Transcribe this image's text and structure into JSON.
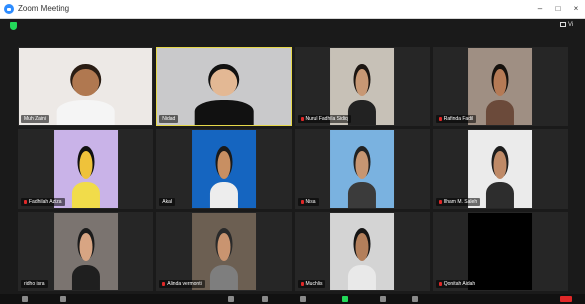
{
  "window": {
    "title": "Zoom Meeting",
    "minimize": "–",
    "maximize": "□",
    "close": "×"
  },
  "header": {
    "view_label": "Vi"
  },
  "participants": [
    {
      "name": "Muh Zaini",
      "muted": false,
      "active": false,
      "bg": "#ede9e6",
      "skin": "#b07850",
      "hair": "#2a1d14",
      "shirt": "#f5f5f5",
      "full": true
    },
    {
      "name": "Nidad",
      "muted": false,
      "active": true,
      "bg": "#c9c9cb",
      "skin": "#e3b894",
      "hair": "#111111",
      "shirt": "#111111",
      "full": true
    },
    {
      "name": "Nurul Fadhila Sidiq",
      "muted": true,
      "active": false,
      "bg": "#c7c1b7",
      "skin": "#c89874",
      "hair": "#1c1612",
      "shirt": "#222222",
      "full": false
    },
    {
      "name": "Rafinda Fadil",
      "muted": true,
      "active": false,
      "bg": "#9f8f83",
      "skin": "#b57a55",
      "hair": "#15110d",
      "shirt": "#6b4a3a",
      "full": false
    },
    {
      "name": "Fadhilah Aziza",
      "muted": true,
      "active": false,
      "bg": "#c9b3e8",
      "skin": "#efc23a",
      "hair": "#111111",
      "shirt": "#f1dc4a",
      "full": false
    },
    {
      "name": "Akal",
      "muted": false,
      "active": false,
      "bg": "#1565c0",
      "skin": "#c88f62",
      "hair": "#1a1a1a",
      "shirt": "#ededed",
      "full": false
    },
    {
      "name": "Nisa",
      "muted": true,
      "active": false,
      "bg": "#7ab2e0",
      "skin": "#c79672",
      "hair": "#222222",
      "shirt": "#3b3b3b",
      "full": false
    },
    {
      "name": "Ilham M. Saleh",
      "muted": true,
      "active": false,
      "bg": "#ebebeb",
      "skin": "#bf8a67",
      "hair": "#1d1d1d",
      "shirt": "#2d2d2d",
      "full": false
    },
    {
      "name": "ridho isra",
      "muted": false,
      "active": false,
      "bg": "#7b7470",
      "skin": "#d8a583",
      "hair": "#1b1b1b",
      "shirt": "#1f1f1f",
      "full": false
    },
    {
      "name": "Alinda vermonti",
      "muted": true,
      "active": false,
      "bg": "#6c5f52",
      "skin": "#c99470",
      "hair": "#2a2a2a",
      "shirt": "#7e7e7e",
      "full": false
    },
    {
      "name": "Muchlis",
      "muted": true,
      "active": false,
      "bg": "#d4d4d4",
      "skin": "#b37f5b",
      "hair": "#151515",
      "shirt": "#e9e9e9",
      "full": false
    },
    {
      "name": "Qonitah Aidah",
      "muted": true,
      "active": false,
      "bg": "#000000",
      "skin": null,
      "hair": null,
      "shirt": null,
      "full": false
    }
  ]
}
